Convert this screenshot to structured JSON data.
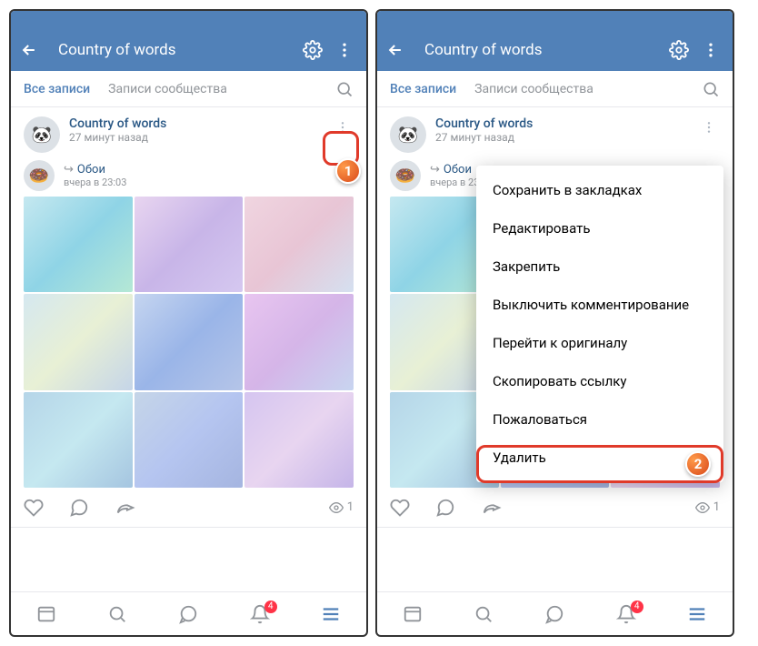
{
  "header": {
    "title": "Country of words"
  },
  "tabs": {
    "all": "Все записи",
    "community": "Записи сообщества"
  },
  "post": {
    "author": "Country of words",
    "time": "27 минут назад",
    "repost_author": "Обои",
    "repost_time": "вчера в 23:03"
  },
  "views": "1",
  "nav_badge": "4",
  "menu": {
    "save": "Сохранить в закладках",
    "edit": "Редактировать",
    "pin": "Закрепить",
    "disable_comments": "Выключить комментирование",
    "goto_original": "Перейти к оригиналу",
    "copy_link": "Скопировать ссылку",
    "report": "Пожаловаться",
    "delete": "Удалить"
  },
  "annotations": {
    "step1": "1",
    "step2": "2"
  }
}
